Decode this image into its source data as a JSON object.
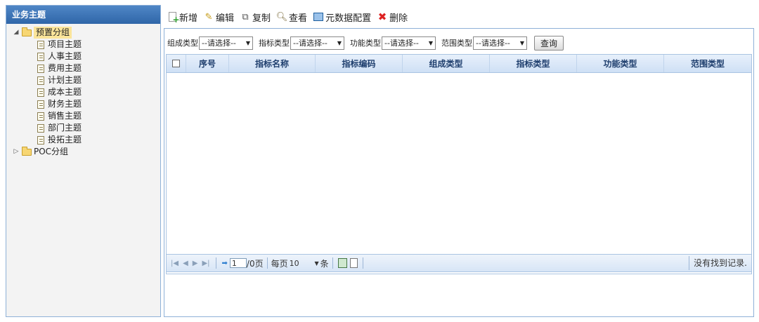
{
  "sidebar": {
    "title": "业务主题",
    "groups": [
      {
        "label": "预置分组",
        "expanded": true,
        "selected": true,
        "items": [
          "项目主题",
          "人事主题",
          "费用主题",
          "计划主题",
          "成本主题",
          "财务主题",
          "销售主题",
          "部门主题",
          "投拓主题"
        ]
      },
      {
        "label": "POC分组",
        "expanded": false,
        "selected": false,
        "items": []
      }
    ]
  },
  "toolbar": {
    "add": "新增",
    "edit": "编辑",
    "copy": "复制",
    "view": "查看",
    "metadata": "元数据配置",
    "delete": "删除"
  },
  "filters": {
    "composition_label": "组成类型",
    "composition_value": "--请选择--",
    "indicator_label": "指标类型",
    "indicator_value": "--请选择--",
    "function_label": "功能类型",
    "function_value": "--请选择--",
    "scope_label": "范围类型",
    "scope_value": "--请选择--",
    "query_button": "查询"
  },
  "grid": {
    "columns": [
      "序号",
      "指标名称",
      "指标编码",
      "组成类型",
      "指标类型",
      "功能类型",
      "范围类型"
    ]
  },
  "pager": {
    "page_value": "1",
    "page_total": "/0页",
    "per_page_label": "每页",
    "per_page_value": "10",
    "per_page_unit": "条",
    "status": "没有找到记录."
  }
}
